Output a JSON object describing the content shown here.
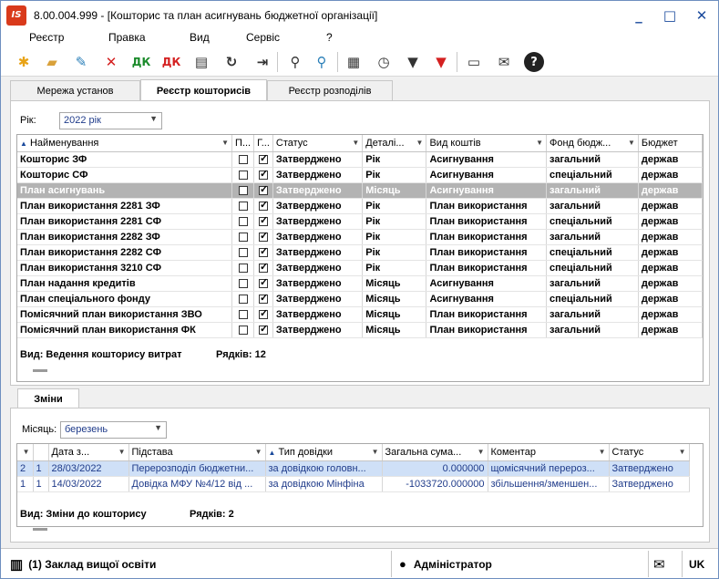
{
  "window": {
    "title": "8.00.004.999 - [Кошторис та план асигнувань бюджетної організації]",
    "logo": "IS",
    "controls": [
      "_",
      "□",
      "✕"
    ]
  },
  "menu": [
    "Реєстр",
    "Правка",
    "Вид",
    "Сервіс",
    "?"
  ],
  "toolbar_icons": [
    "new-doc-icon",
    "open-folder-icon",
    "edit-doc-icon",
    "delete-doc-icon",
    "approve-icon",
    "unapprove-icon",
    "print-icon",
    "refresh-icon",
    "exit-icon",
    "search-icon",
    "find-next-icon",
    "table-icon",
    "history-icon",
    "filter-icon",
    "clear-filter-icon",
    "document-icon",
    "mail-icon",
    "help-icon"
  ],
  "tabs": [
    "Мережа установ",
    "Реєстр кошторисів",
    "Реєстр розподілів"
  ],
  "active_tab": 1,
  "year": {
    "label": "Рік:",
    "value": "2022 рік"
  },
  "grid1": {
    "columns": [
      "Найменування",
      "П...",
      "Г...",
      "Статус",
      "Деталі...",
      "Вид коштів",
      "Фонд бюдж...",
      "Бюджет"
    ],
    "rows": [
      {
        "name": "Кошторис ЗФ",
        "p": false,
        "g": true,
        "status": "Затверджено",
        "detail": "Рік",
        "kind": "Асигнування",
        "fund": "загальний",
        "budget": "держав"
      },
      {
        "name": "Кошторис СФ",
        "p": false,
        "g": true,
        "status": "Затверджено",
        "detail": "Рік",
        "kind": "Асигнування",
        "fund": "спеціальний",
        "budget": "держав"
      },
      {
        "name": "План асигнувань",
        "p": false,
        "g": true,
        "status": "Затверджено",
        "detail": "Місяць",
        "kind": "Асигнування",
        "fund": "загальний",
        "budget": "держав"
      },
      {
        "name": "План використання 2281 ЗФ",
        "p": false,
        "g": true,
        "status": "Затверджено",
        "detail": "Рік",
        "kind": "План використання",
        "fund": "загальний",
        "budget": "держав"
      },
      {
        "name": "План використання 2281 СФ",
        "p": false,
        "g": true,
        "status": "Затверджено",
        "detail": "Рік",
        "kind": "План використання",
        "fund": "спеціальний",
        "budget": "держав"
      },
      {
        "name": "План використання 2282 ЗФ",
        "p": false,
        "g": true,
        "status": "Затверджено",
        "detail": "Рік",
        "kind": "План використання",
        "fund": "загальний",
        "budget": "держав"
      },
      {
        "name": "План використання 2282 СФ",
        "p": false,
        "g": true,
        "status": "Затверджено",
        "detail": "Рік",
        "kind": "План використання",
        "fund": "спеціальний",
        "budget": "держав"
      },
      {
        "name": "План використання 3210 СФ",
        "p": false,
        "g": true,
        "status": "Затверджено",
        "detail": "Рік",
        "kind": "План використання",
        "fund": "спеціальний",
        "budget": "держав"
      },
      {
        "name": "План надання кредитів",
        "p": false,
        "g": true,
        "status": "Затверджено",
        "detail": "Місяць",
        "kind": "Асигнування",
        "fund": "загальний",
        "budget": "держав"
      },
      {
        "name": "План спеціального фонду",
        "p": false,
        "g": true,
        "status": "Затверджено",
        "detail": "Місяць",
        "kind": "Асигнування",
        "fund": "спеціальний",
        "budget": "держав"
      },
      {
        "name": "Помісячний план використання ЗВО",
        "p": false,
        "g": true,
        "status": "Затверджено",
        "detail": "Місяць",
        "kind": "План використання",
        "fund": "загальний",
        "budget": "держав"
      },
      {
        "name": "Помісячний план використання ФК",
        "p": false,
        "g": true,
        "status": "Затверджено",
        "detail": "Місяць",
        "kind": "План використання",
        "fund": "загальний",
        "budget": "держав"
      }
    ],
    "selected_row": 2,
    "footer_view": "Вид: Ведення кошторису витрат",
    "footer_rows": "Рядків: 12"
  },
  "changes_tab": "Зміни",
  "month": {
    "label": "Місяць:",
    "value": "березень"
  },
  "grid2": {
    "columns": [
      "",
      "",
      "Дата з...",
      "Підстава",
      "Тип довідки",
      "Загальна сума...",
      "Коментар",
      "Статус"
    ],
    "rows": [
      {
        "n": "2",
        "c": "1",
        "date": "28/03/2022",
        "basis": "Перерозподіл бюджетни...",
        "type": "за довідкою головн...",
        "sum": "0.000000",
        "comment": "щомісячний перероз...",
        "status": "Затверджено"
      },
      {
        "n": "1",
        "c": "1",
        "date": "14/03/2022",
        "basis": "Довідка МФУ №4/12 від ...",
        "type": "за довідкою Мінфіна",
        "sum": "-1033720.000000",
        "comment": "збільшення/зменшен...",
        "status": "Затверджено"
      }
    ],
    "selected_row": 0,
    "footer_view": "Вид: Зміни до кошторису",
    "footer_rows": "Рядків: 2"
  },
  "statusbar": {
    "org": "(1) Заклад вищої освіти",
    "user": "Адміністратор",
    "lang": "UK"
  }
}
